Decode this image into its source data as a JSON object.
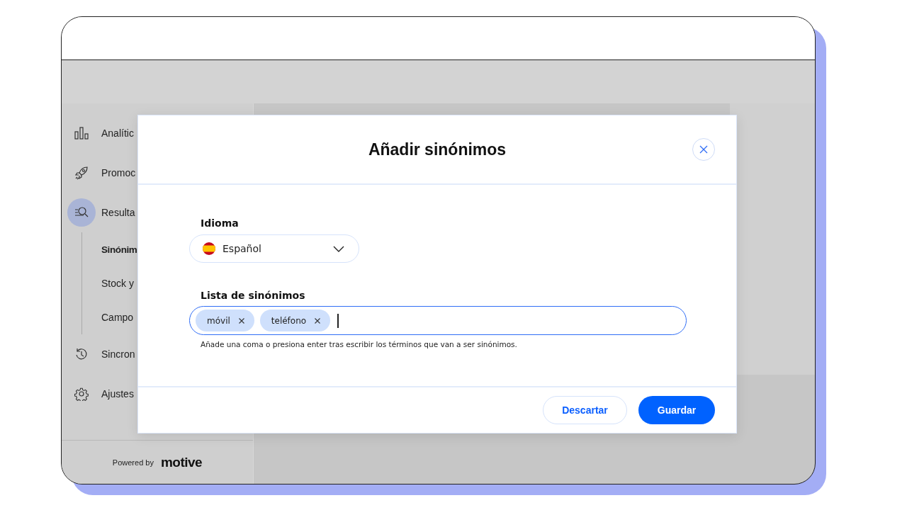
{
  "sidebar": {
    "items": [
      {
        "label": "Analític",
        "selected": false
      },
      {
        "label": "Promoc",
        "selected": false
      },
      {
        "label": "Resulta",
        "selected": true,
        "children": [
          {
            "label": "Sinónim",
            "selected": true
          },
          {
            "label": "Stock y",
            "selected": false
          },
          {
            "label": "Campo",
            "selected": false
          }
        ]
      },
      {
        "label": "Sincron",
        "selected": false
      },
      {
        "label": "Ajustes",
        "selected": false
      }
    ],
    "footer": {
      "text": "Powered by",
      "logo": "motive"
    }
  },
  "dialog": {
    "title": "Añadir sinónimos",
    "language": {
      "label": "Idioma",
      "value": "Español"
    },
    "synonyms": {
      "label": "Lista de sinónimos",
      "tags": [
        "móvil",
        "teléfono"
      ],
      "hint": "Añade una coma o presiona enter tras escribir los términos que van a ser sinónimos."
    },
    "buttons": [
      {
        "label": "Descartar",
        "kind": "secondary"
      },
      {
        "label": "Guardar",
        "kind": "primary"
      }
    ]
  }
}
